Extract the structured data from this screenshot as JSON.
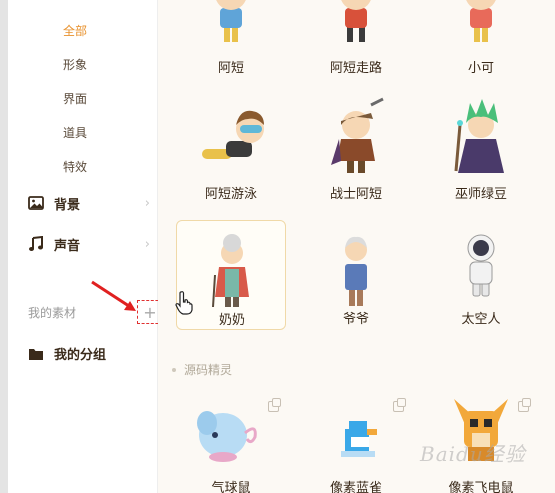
{
  "sidebar": {
    "sub_items": [
      {
        "label": "全部",
        "active": true
      },
      {
        "label": "形象",
        "active": false
      },
      {
        "label": "界面",
        "active": false
      },
      {
        "label": "道具",
        "active": false
      },
      {
        "label": "特效",
        "active": false
      }
    ],
    "categories": [
      {
        "label": "背景",
        "icon": "image-icon"
      },
      {
        "label": "声音",
        "icon": "music-note-icon"
      }
    ],
    "my_assets": {
      "label": "我的素材",
      "add_symbol": "+"
    },
    "my_group": {
      "label": "我的分组",
      "icon": "folder-icon"
    }
  },
  "assets": [
    {
      "name": "阿短"
    },
    {
      "name": "阿短走路"
    },
    {
      "name": "小可"
    },
    {
      "name": "阿短游泳"
    },
    {
      "name": "战士阿短"
    },
    {
      "name": "巫师绿豆"
    },
    {
      "name": "奶奶",
      "selected": true
    },
    {
      "name": "爷爷"
    },
    {
      "name": "太空人"
    }
  ],
  "section": {
    "title": "源码精灵"
  },
  "section_assets": [
    {
      "name": "气球鼠"
    },
    {
      "name": "像素蓝雀"
    },
    {
      "name": "像素飞电鼠"
    }
  ],
  "watermark": "Baidu经验",
  "colors": {
    "accent": "#e8912c",
    "highlight_border": "#e03030",
    "selected_border": "#f0d9a8"
  }
}
